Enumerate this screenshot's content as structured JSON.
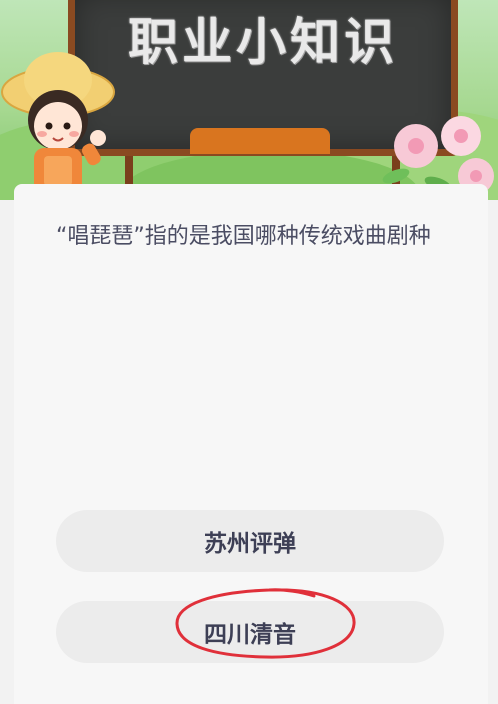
{
  "banner": {
    "title": "职业小知识"
  },
  "question": {
    "text": "“唱琵琶”指的是我国哪种传统戏曲剧种"
  },
  "options": [
    {
      "label": "苏州评弹"
    },
    {
      "label": "四川清音",
      "highlighted": true
    }
  ],
  "colors": {
    "highlight_circle": "#e0303a",
    "question_text": "#4b4d63",
    "option_bg": "#ececec"
  }
}
